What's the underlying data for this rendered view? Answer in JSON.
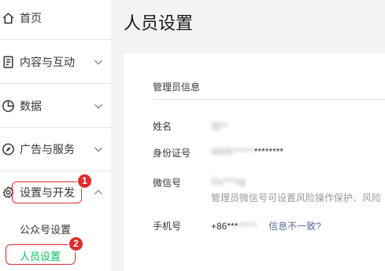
{
  "sidebar": {
    "items": [
      {
        "label": "首页",
        "icon": "home-icon",
        "has_chevron": false
      },
      {
        "label": "内容与互动",
        "icon": "document-icon",
        "has_chevron": true
      },
      {
        "label": "数据",
        "icon": "pie-chart-icon",
        "has_chevron": true
      },
      {
        "label": "广告与服务",
        "icon": "compass-icon",
        "has_chevron": true
      },
      {
        "label": "设置与开发",
        "icon": "gear-icon",
        "has_chevron": true,
        "expanded": true
      }
    ],
    "sub_items": [
      {
        "label": "公众号设置",
        "active": false
      },
      {
        "label": "人员设置",
        "active": true
      }
    ]
  },
  "annotations": [
    {
      "number": "1",
      "target": "设置与开发"
    },
    {
      "number": "2",
      "target": "人员设置"
    }
  ],
  "page": {
    "title": "人员设置"
  },
  "admin_info": {
    "section_title": "管理员信息",
    "name": {
      "label": "姓名",
      "value": "刘**"
    },
    "id_number": {
      "label": "身份证号",
      "masked_prefix": "4405******",
      "visible_suffix": "********"
    },
    "wechat": {
      "label": "微信号",
      "value": "Gu***ng",
      "hint": "管理员微信号可设置风险操作保护、风险"
    },
    "phone": {
      "label": "手机号",
      "prefix": "+86***",
      "masked": "*****",
      "link": "信息不一致?"
    }
  },
  "colors": {
    "accent_green": "#07c160",
    "annotation_red": "#e02b2b",
    "link_blue": "#576b95",
    "background": "#f2f3f5"
  }
}
